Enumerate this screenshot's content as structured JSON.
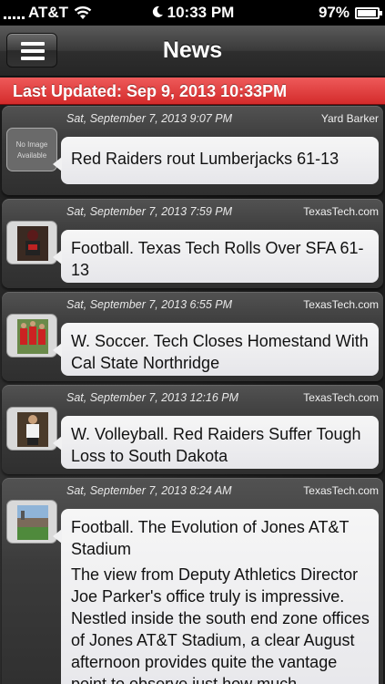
{
  "status_bar": {
    "carrier": "AT&T",
    "time": "10:33 PM",
    "battery_percent_text": "97%",
    "battery_level": 0.97
  },
  "nav": {
    "title": "News"
  },
  "banner": {
    "last_updated": "Last Updated: Sep 9, 2013 10:33PM",
    "color": "#d42b2b"
  },
  "thumbnail_placeholder": "No Image Available",
  "articles": [
    {
      "date": "Sat, September 7, 2013 9:07 PM",
      "source": "Yard Barker",
      "title": "Red Raiders rout Lumberjacks 61-13",
      "thumbnail": "none"
    },
    {
      "date": "Sat, September 7, 2013 7:59 PM",
      "source": "TexasTech.com",
      "title": "Football. Texas Tech Rolls Over SFA 61-13",
      "thumbnail": "football-player-photo"
    },
    {
      "date": "Sat, September 7, 2013 6:55 PM",
      "source": "TexasTech.com",
      "title": "W. Soccer. Tech Closes Homestand With Cal State Northridge",
      "thumbnail": "soccer-team-photo"
    },
    {
      "date": "Sat, September 7, 2013 12:16 PM",
      "source": "TexasTech.com",
      "title": "W. Volleyball. Red Raiders Suffer Tough Loss to South Dakota",
      "thumbnail": "volleyball-player-photo"
    },
    {
      "date": "Sat, September 7, 2013 8:24 AM",
      "source": "TexasTech.com",
      "title": "Football. The Evolution of Jones AT&T Stadium",
      "description": "The view from Deputy Athletics Director Joe Parker's office truly is impressive. Nestled inside the south end zone offices of Jones AT&T Stadium, a clear August afternoon provides quite the vantage point to observe just how much",
      "thumbnail": "stadium-photo"
    }
  ]
}
